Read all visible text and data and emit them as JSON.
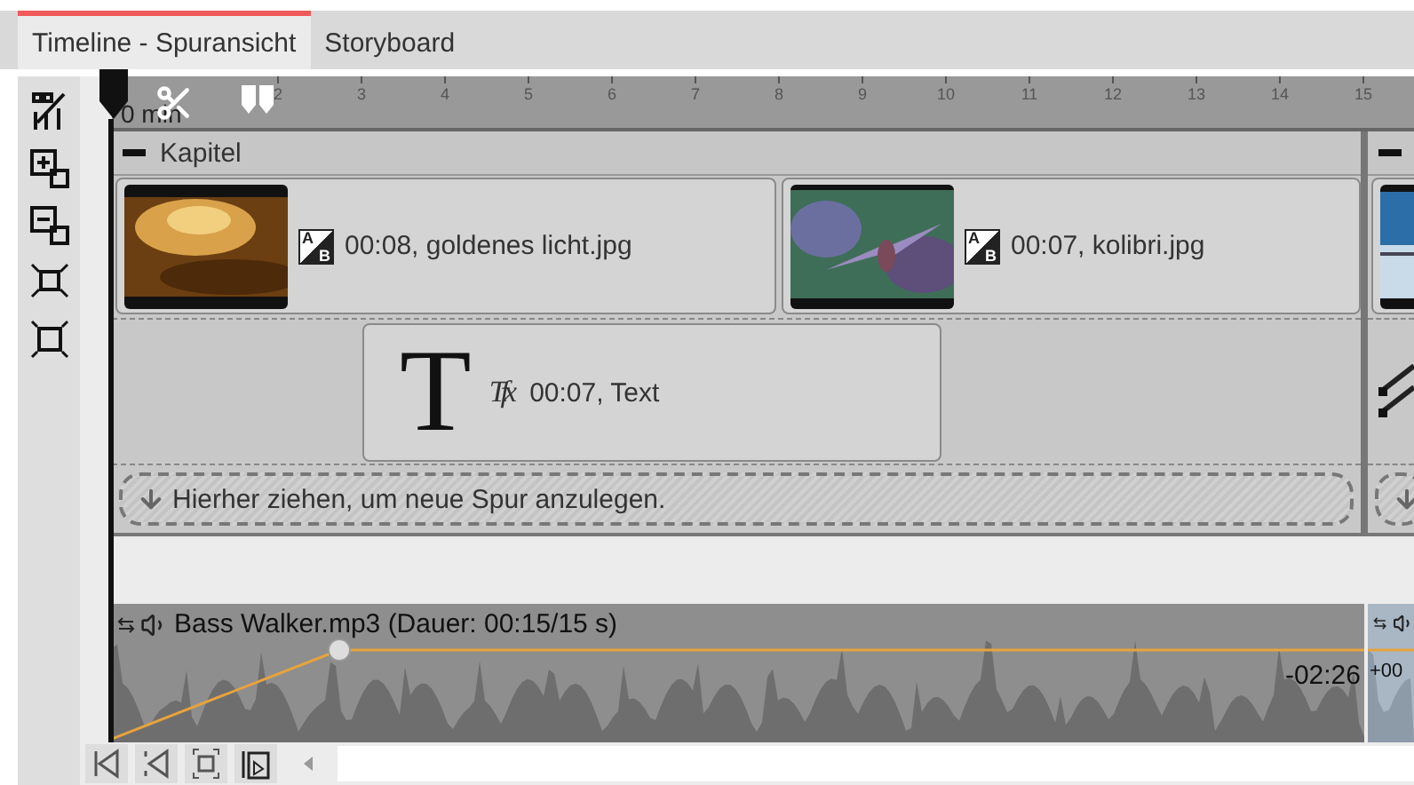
{
  "tabs": [
    {
      "label": "Timeline - Spuransicht",
      "selected": true
    },
    {
      "label": "Storyboard",
      "selected": false
    }
  ],
  "ruler": {
    "start_label": "0 min",
    "ticks": [
      "2",
      "3",
      "4",
      "5",
      "6",
      "7",
      "8",
      "9",
      "10",
      "11",
      "12",
      "13",
      "14",
      "15"
    ]
  },
  "chapters": [
    {
      "title": "Kapitel",
      "expanded": true,
      "image_clips": [
        {
          "transition": [
            "A",
            "B"
          ],
          "label": "00:08, goldenes licht.jpg"
        },
        {
          "transition": [
            "A",
            "B"
          ],
          "label": "00:07, kolibri.jpg"
        }
      ],
      "text_clips": [
        {
          "symbol": "T",
          "effect": "Tfx",
          "label": "00:07, Text"
        }
      ],
      "drop_hint": "Hierher ziehen, um neue Spur anzulegen."
    },
    {
      "expanded": true
    }
  ],
  "audio": [
    {
      "label": "Bass Walker.mp3 (Dauer: 00:15/15 s)",
      "offset": "-02:26"
    },
    {
      "offset": "+00"
    }
  ]
}
